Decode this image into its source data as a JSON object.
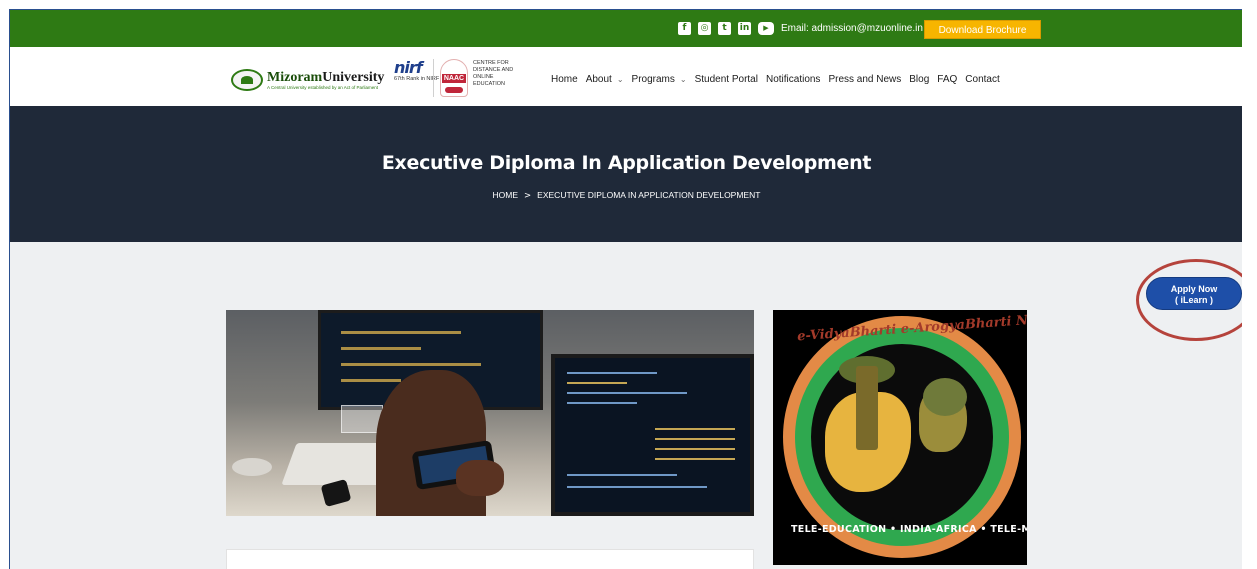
{
  "topbar": {
    "social_icons": [
      "facebook-icon",
      "instagram-icon",
      "twitter-icon",
      "linkedin-icon",
      "youtube-icon"
    ],
    "email_text": "Email: admission@mzuonline.in",
    "brochure_label": "Download Brochure",
    "bg_color": "#2e7a14",
    "accent_color": "#f7b500"
  },
  "header": {
    "university_name": "Mizoram",
    "university_name_2": "University",
    "university_tagline": "A Central University established by an Act of Parliament",
    "nirf_logo": "nirf",
    "nirf_rank": "67th Rank in NIRF 2020",
    "naac_logo": "NAAC",
    "cdoe_text": "CENTRE FOR\nDISTANCE AND\nONLINE\nEDUCATION",
    "nav": [
      {
        "label": "Home"
      },
      {
        "label": "About"
      },
      {
        "label": "Programs"
      },
      {
        "label": "Student Portal"
      },
      {
        "label": "Notifications"
      },
      {
        "label": "Press and News"
      },
      {
        "label": "Blog"
      },
      {
        "label": "FAQ"
      },
      {
        "label": "Contact"
      }
    ]
  },
  "banner": {
    "title": "Executive Diploma In Application Development",
    "breadcrumb_home": "HOME",
    "breadcrumb_sep": ">",
    "breadcrumb_current": "EXECUTIVE DIPLOMA IN APPLICATION DEVELOPMENT",
    "bg_color": "#1f2939"
  },
  "apply": {
    "label": "Apply Now\n( iLearn )",
    "color": "#1e4fa8"
  },
  "network_logo": {
    "top_text": "e-VidyaBharti e-ArogyaBharti Network Project",
    "bottom_text": "TELE-EDUCATION • INDIA-AFRICA • TELE-MEDICINE"
  }
}
